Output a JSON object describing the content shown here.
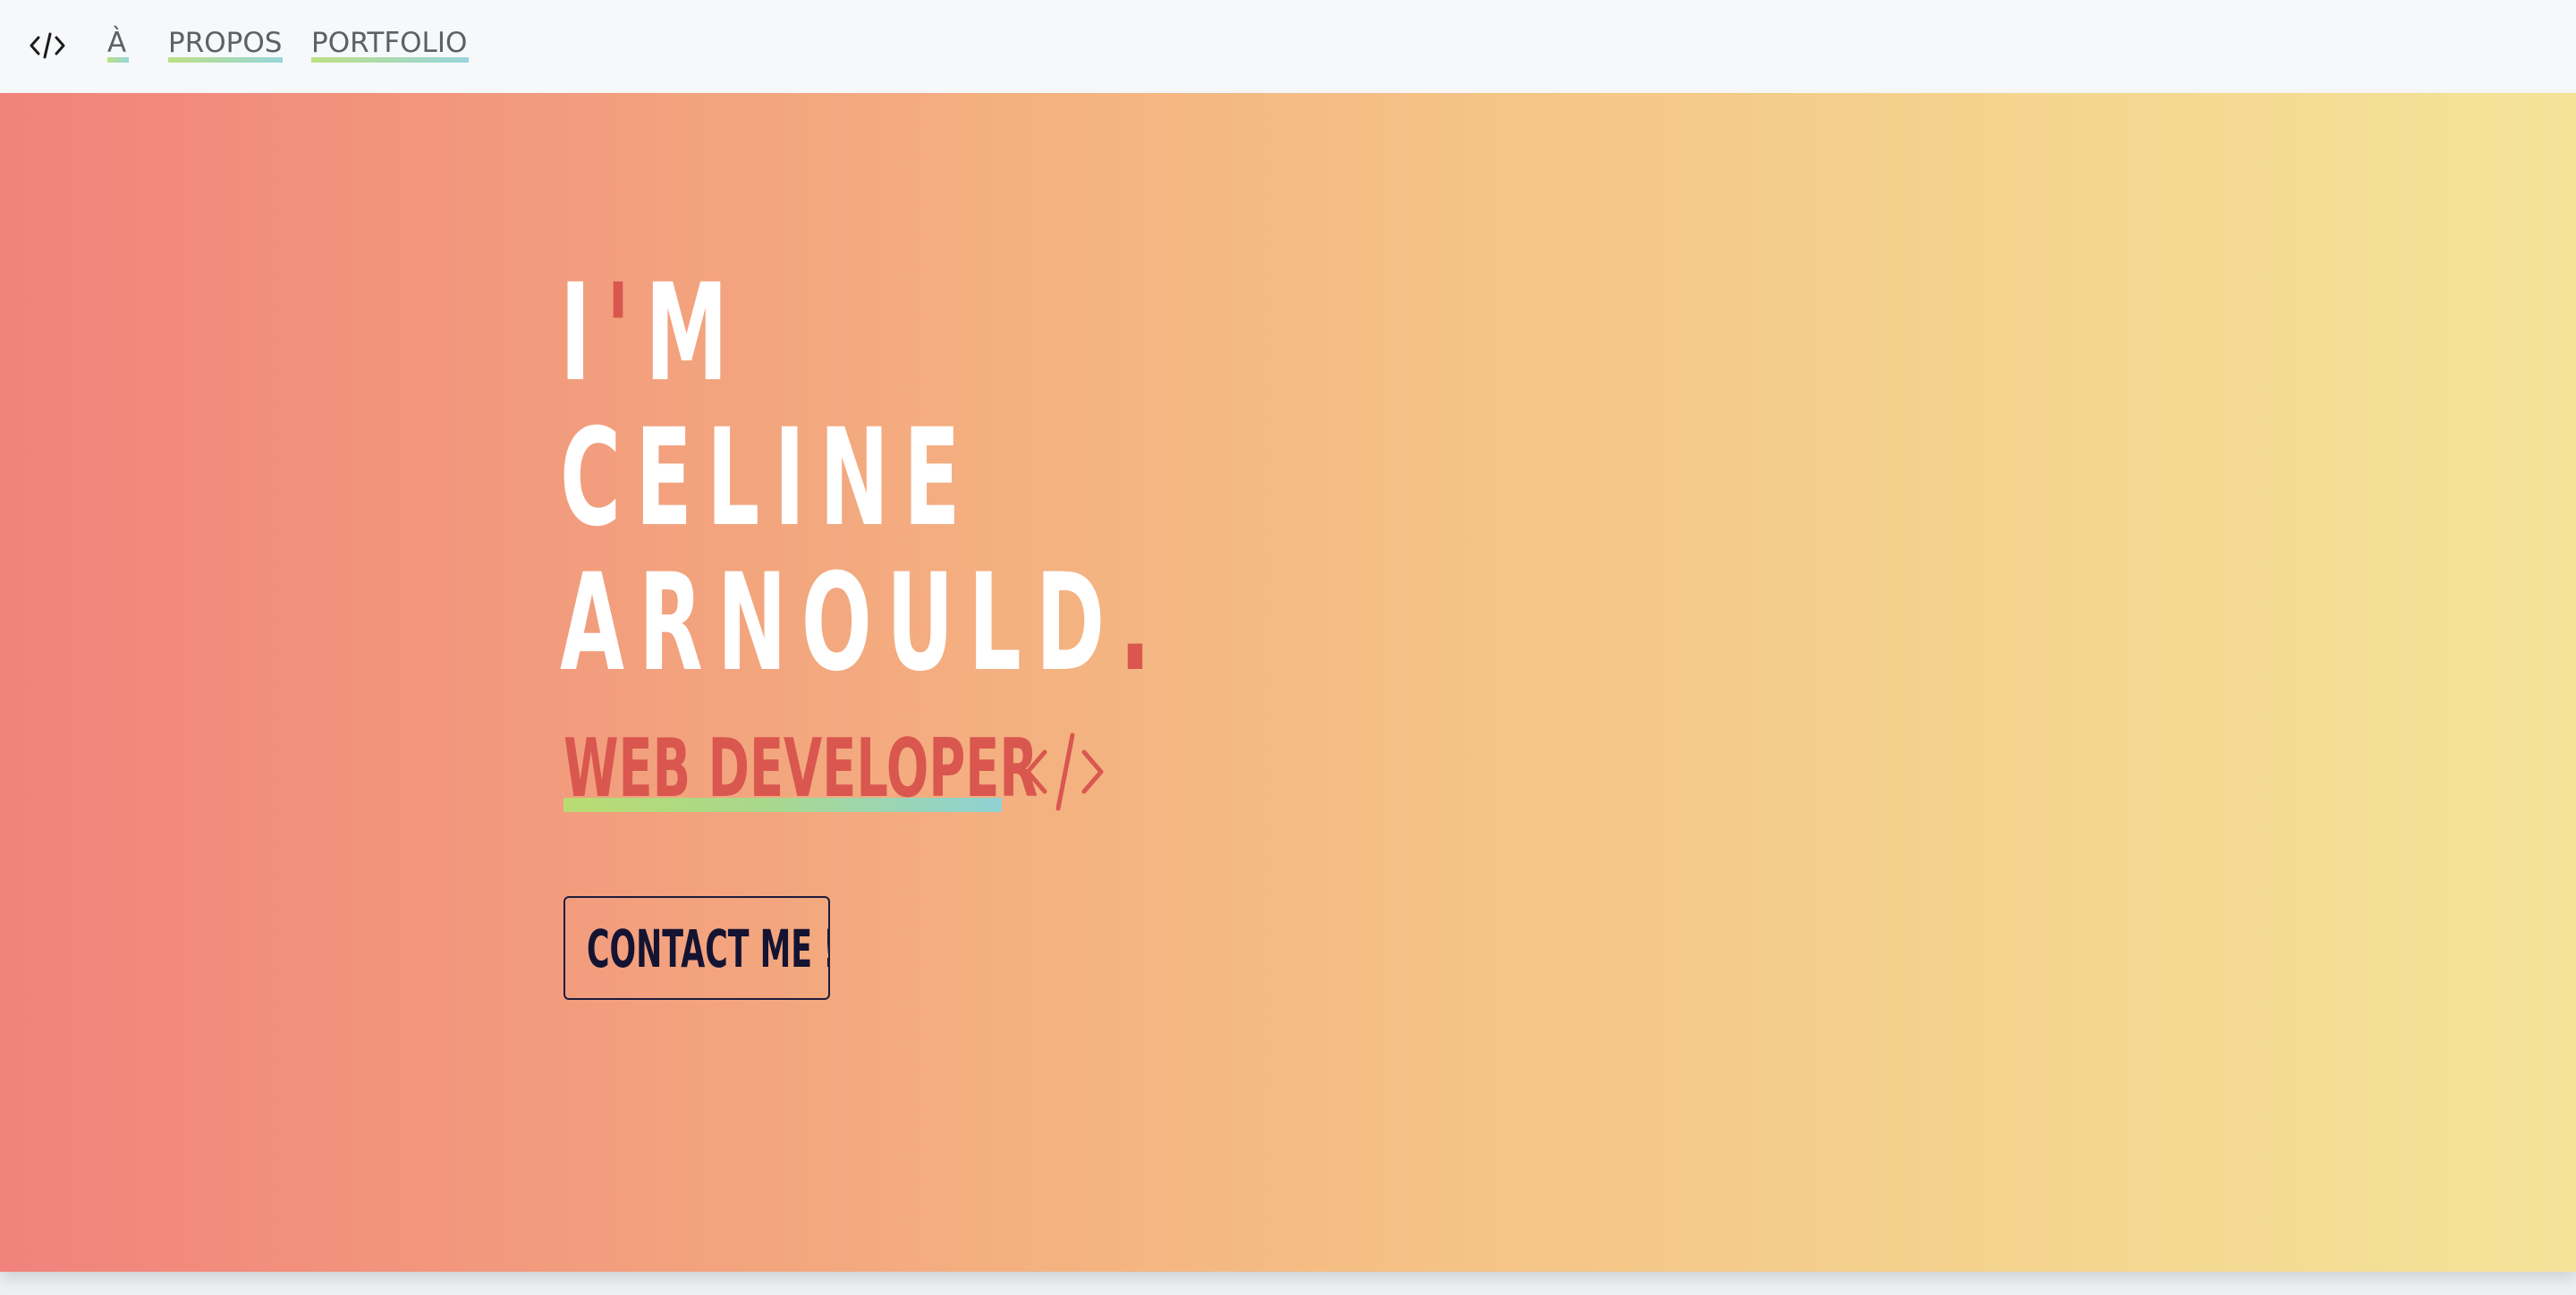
{
  "navbar": {
    "brand_icon": "code-icon",
    "links": [
      {
        "label": "À"
      },
      {
        "label": "PROPOS"
      },
      {
        "label": "PORTFOLIO"
      }
    ]
  },
  "hero": {
    "headline": {
      "line1_a": "I",
      "line1_apostrophe": "'",
      "line1_b": "M",
      "line2": "CELINE",
      "line3": "ARNOULD",
      "line3_dot": "."
    },
    "subtitle": "WEB DEVELOPER",
    "subtitle_icon": "code-icon",
    "contact_button": "CONTACT ME !"
  },
  "colors": {
    "accent": "#d9574f",
    "gradient_start": "#f1827c",
    "gradient_end": "#f5e39a",
    "button_ink": "#141432",
    "underline_start": "#b9dc72",
    "underline_end": "#8fd2d4"
  }
}
